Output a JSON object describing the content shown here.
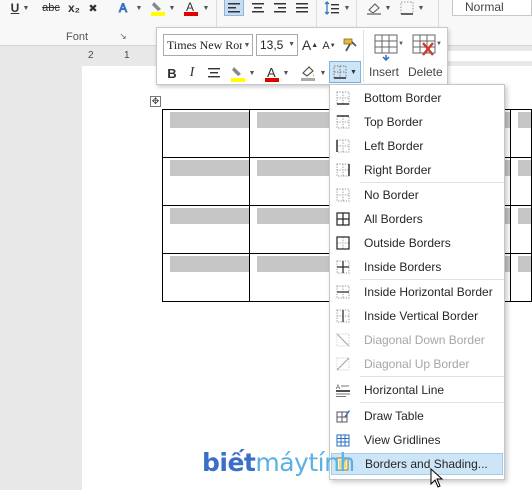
{
  "ribbon": {
    "underline": "U",
    "strike": "abc",
    "subscript": "x₂",
    "clear": "✖",
    "group_label": "Font",
    "style_normal": "Normal"
  },
  "ruler": {
    "numbers": [
      "2",
      "1"
    ]
  },
  "mini_toolbar": {
    "font_name": "Times New Roman",
    "font_size": "13,5",
    "insert_label": "Insert",
    "delete_label": "Delete"
  },
  "borders_menu": {
    "items": [
      {
        "label": "Bottom Border",
        "icon": "border-bottom-icon",
        "disabled": false
      },
      {
        "label": "Top Border",
        "icon": "border-top-icon",
        "disabled": false
      },
      {
        "label": "Left Border",
        "icon": "border-left-icon",
        "disabled": false
      },
      {
        "label": "Right Border",
        "icon": "border-right-icon",
        "disabled": false
      },
      {
        "label": "No Border",
        "icon": "border-none-icon",
        "disabled": false
      },
      {
        "label": "All Borders",
        "icon": "border-all-icon",
        "disabled": false
      },
      {
        "label": "Outside Borders",
        "icon": "border-outside-icon",
        "disabled": false
      },
      {
        "label": "Inside Borders",
        "icon": "border-inside-icon",
        "disabled": false
      },
      {
        "label": "Inside Horizontal Border",
        "icon": "border-inside-horizontal-icon",
        "disabled": false
      },
      {
        "label": "Inside Vertical Border",
        "icon": "border-inside-vertical-icon",
        "disabled": false
      },
      {
        "label": "Diagonal Down Border",
        "icon": "border-diagonal-down-icon",
        "disabled": true
      },
      {
        "label": "Diagonal Up Border",
        "icon": "border-diagonal-up-icon",
        "disabled": true
      },
      {
        "label": "Horizontal Line",
        "icon": "horizontal-line-icon",
        "disabled": false
      },
      {
        "label": "Draw Table",
        "icon": "draw-table-icon",
        "disabled": false
      },
      {
        "label": "View Gridlines",
        "icon": "view-gridlines-icon",
        "disabled": false
      },
      {
        "label": "Borders and Shading...",
        "icon": "borders-shading-icon",
        "disabled": false
      }
    ]
  },
  "watermark": {
    "part1": "biết",
    "part2": "máytính"
  },
  "colors": {
    "highlight": "#ffff00",
    "font_color": "#e00000",
    "menu_hover": "#cde6f7",
    "cell_shading": "#c6c6c6"
  }
}
